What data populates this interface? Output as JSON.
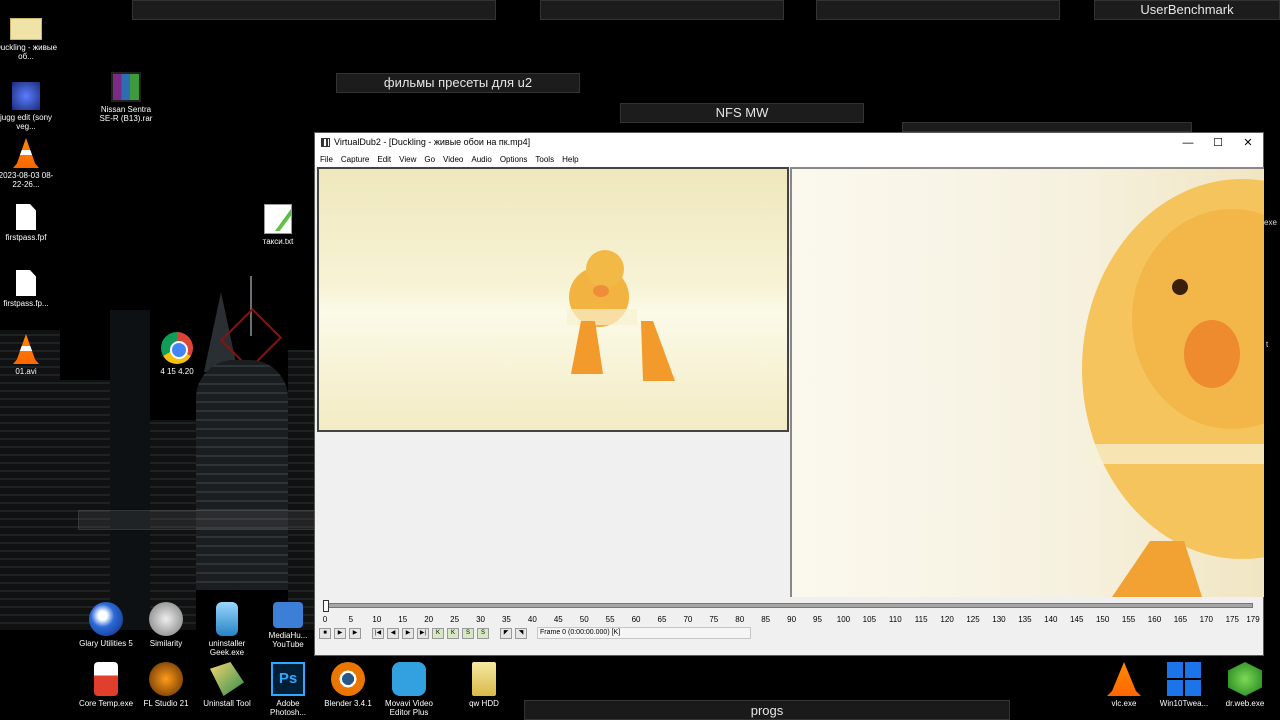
{
  "desktop": {
    "top_bars": [
      "",
      "",
      "",
      "UserBenchmark"
    ],
    "bar2": "фильмы пресеты для u2",
    "bar3": "NFS MW",
    "progs": "progs",
    "icons": [
      {
        "label": "Duckling - живые об...",
        "icon": "video-thumbnail-icon"
      },
      {
        "label": "jugg edit (sony veg...",
        "icon": "vegas-project-icon"
      },
      {
        "label": "Nissan Sentra SE-R (B13).rar",
        "icon": "winrar-icon"
      },
      {
        "label": "2023-08-03 08-22-26...",
        "icon": "vlc-icon"
      },
      {
        "label": "firstpass.fpf",
        "icon": "file-icon"
      },
      {
        "label": "такси.txt",
        "icon": "text-file-icon"
      },
      {
        "label": "firstpass.fp...",
        "icon": "file-icon"
      },
      {
        "label": "01.avi",
        "icon": "vlc-icon"
      },
      {
        "label": "4 15 4.20",
        "icon": "chrome-icon"
      }
    ],
    "right_edge": [
      "exe",
      "t"
    ],
    "taskbar_top": [
      {
        "label": "Glary Utilities 5"
      },
      {
        "label": "Similarity"
      },
      {
        "label": "uninstaller Geek.exe"
      },
      {
        "label": "MediaHu... YouTube"
      }
    ],
    "taskbar_bottom": [
      {
        "label": "Core Temp.exe"
      },
      {
        "label": "FL Studio 21"
      },
      {
        "label": "Uninstall Tool"
      },
      {
        "label": "Adobe Photosh..."
      },
      {
        "label": "Blender 3.4.1"
      },
      {
        "label": "Movavi Video Editor Plus"
      },
      {
        "label": "qw HDD"
      }
    ],
    "taskbar_right": [
      {
        "label": "vlc.exe"
      },
      {
        "label": "Win10Twea..."
      },
      {
        "label": "dr.web.exe"
      }
    ]
  },
  "window": {
    "title": "VirtualDub2 - [Duckling - живые обои на пк.mp4]",
    "controls": {
      "minimize": "—",
      "maximize": "☐",
      "close": "✕"
    },
    "menu": [
      "File",
      "Capture",
      "Edit",
      "View",
      "Go",
      "Video",
      "Audio",
      "Options",
      "Tools",
      "Help"
    ],
    "frame_info": "Frame 0 (0:00:00.000) [K]",
    "ticks": [
      "0",
      "5",
      "10",
      "15",
      "20",
      "25",
      "30",
      "35",
      "40",
      "45",
      "50",
      "55",
      "60",
      "65",
      "70",
      "75",
      "80",
      "85",
      "90",
      "95",
      "100",
      "105",
      "110",
      "115",
      "120",
      "125",
      "130",
      "135",
      "140",
      "145",
      "150",
      "155",
      "160",
      "165",
      "170",
      "175",
      "179"
    ],
    "tick_max": 179,
    "position_fraction": 0
  }
}
